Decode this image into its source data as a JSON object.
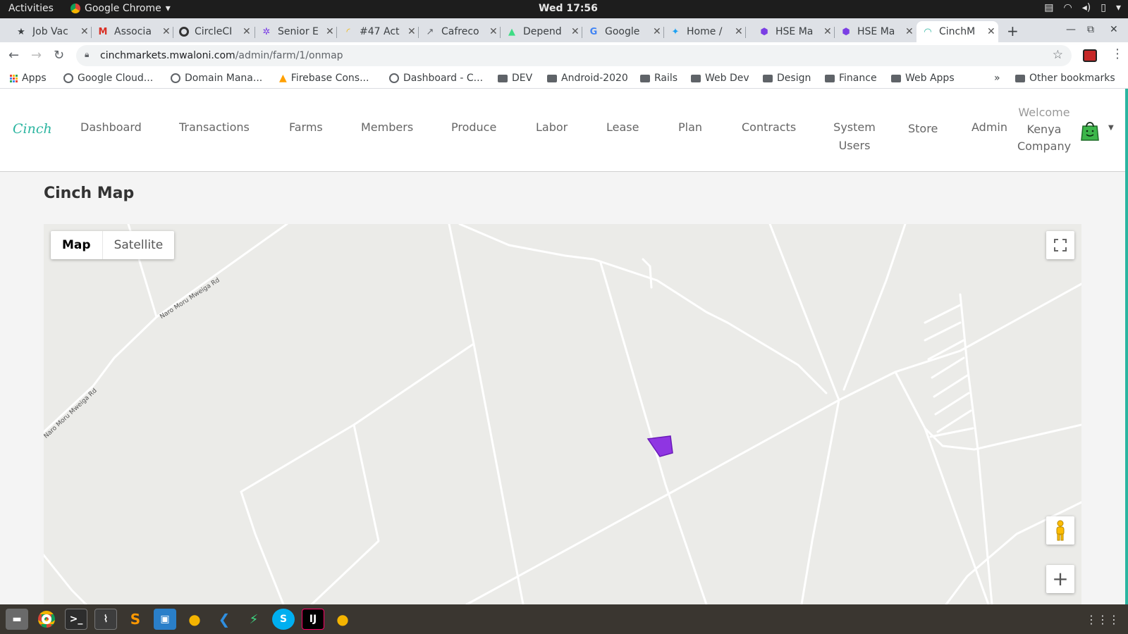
{
  "system": {
    "activities": "Activities",
    "app_name": "Google Chrome",
    "clock": "Wed 17:56"
  },
  "tabs": [
    {
      "label": "Job Vac",
      "icon": "pin-icon",
      "color": "#333333"
    },
    {
      "label": "Associa",
      "icon": "gmail-icon",
      "color": "#d93025"
    },
    {
      "label": "CircleCI",
      "icon": "circleci-icon",
      "color": "#343434"
    },
    {
      "label": "Senior E",
      "icon": "gear-icon",
      "color": "#7b3fe4"
    },
    {
      "label": "#47 Act",
      "icon": "rainbow-icon",
      "color": "#f4b400"
    },
    {
      "label": "Cafreco",
      "icon": "arrow-icon",
      "color": "#5f6368"
    },
    {
      "label": "Depend",
      "icon": "android-icon",
      "color": "#3ddc84"
    },
    {
      "label": "Google",
      "icon": "google-icon",
      "color": "#4285f4"
    },
    {
      "label": "Home /",
      "icon": "twitter-icon",
      "color": "#1da1f2"
    },
    {
      "label": "HSE Ma",
      "icon": "cube-icon",
      "color": "#7b3fe4"
    },
    {
      "label": "HSE Ma",
      "icon": "cube-icon",
      "color": "#7b3fe4"
    },
    {
      "label": "CinchM",
      "icon": "cinch-icon",
      "color": "#2bb5a0"
    }
  ],
  "address_bar": {
    "domain": "cinchmarkets.mwaloni.com",
    "path": "/admin/farm/1/onmap"
  },
  "bookmarks": [
    {
      "label": "Apps",
      "icon": "apps-icon"
    },
    {
      "label": "Google Cloud...",
      "icon": "globe-icon"
    },
    {
      "label": "Domain Mana...",
      "icon": "globe-icon"
    },
    {
      "label": "Firebase Cons...",
      "icon": "firebase-icon"
    },
    {
      "label": "Dashboard - C...",
      "icon": "globe-icon"
    },
    {
      "label": "DEV",
      "icon": "folder-icon"
    },
    {
      "label": "Android-2020",
      "icon": "folder-icon"
    },
    {
      "label": "Rails",
      "icon": "folder-icon"
    },
    {
      "label": "Web Dev",
      "icon": "folder-icon"
    },
    {
      "label": "Design",
      "icon": "folder-icon"
    },
    {
      "label": "Finance",
      "icon": "folder-icon"
    },
    {
      "label": "Web Apps",
      "icon": "folder-icon"
    }
  ],
  "bookmarks_more": "»",
  "other_bookmarks": "Other bookmarks",
  "app": {
    "logo": "Cinch",
    "nav": [
      "Dashboard",
      "Transactions",
      "Farms",
      "Members",
      "Produce",
      "Labor",
      "Lease",
      "Plan",
      "Contracts"
    ],
    "nav_system_users": [
      "System",
      "Users"
    ],
    "nav_store": "Store",
    "nav_admin": "Admin",
    "welcome": "Welcome",
    "welcome_name_1": "Kenya",
    "welcome_name_2": "Company",
    "page_title": "Cinch Map"
  },
  "map": {
    "type_map": "Map",
    "type_satellite": "Satellite",
    "road_label_1": "Naro Moru Mweiga Rd",
    "road_label_2": "Naro Moru Mweiga Rd",
    "farm_polygon_color": "#8a2be2"
  },
  "colors": {
    "accent": "#2bb5a0"
  }
}
